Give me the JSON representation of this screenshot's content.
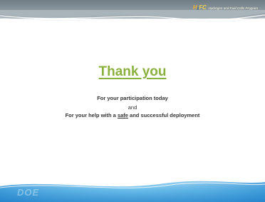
{
  "header": {
    "logo_mark": {
      "h": "H",
      "main": "₂",
      "fc": "FC"
    },
    "logo_text": "Hydrogen and Fuel Cells Program"
  },
  "content": {
    "title": "Thank you",
    "line1": "For your participation today",
    "line2": "and",
    "line3_prefix": "For your help with a ",
    "line3_underlined": "safe",
    "line3_suffix": " and successful deployment"
  },
  "footer": {
    "logo_text": "DOE"
  },
  "colors": {
    "title": "#8ab03e",
    "header_band": "#7d8990",
    "footer_band": "#2f8fd0"
  }
}
